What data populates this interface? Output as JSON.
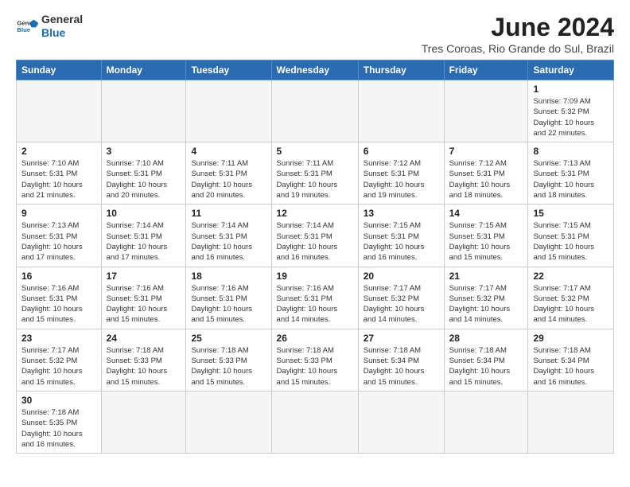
{
  "header": {
    "logo_general": "General",
    "logo_blue": "Blue",
    "title": "June 2024",
    "location": "Tres Coroas, Rio Grande do Sul, Brazil"
  },
  "days_of_week": [
    "Sunday",
    "Monday",
    "Tuesday",
    "Wednesday",
    "Thursday",
    "Friday",
    "Saturday"
  ],
  "weeks": [
    [
      {
        "day": null,
        "info": null
      },
      {
        "day": null,
        "info": null
      },
      {
        "day": null,
        "info": null
      },
      {
        "day": null,
        "info": null
      },
      {
        "day": null,
        "info": null
      },
      {
        "day": null,
        "info": null
      },
      {
        "day": "1",
        "info": "Sunrise: 7:09 AM\nSunset: 5:32 PM\nDaylight: 10 hours\nand 22 minutes."
      }
    ],
    [
      {
        "day": "2",
        "info": "Sunrise: 7:10 AM\nSunset: 5:31 PM\nDaylight: 10 hours\nand 21 minutes."
      },
      {
        "day": "3",
        "info": "Sunrise: 7:10 AM\nSunset: 5:31 PM\nDaylight: 10 hours\nand 20 minutes."
      },
      {
        "day": "4",
        "info": "Sunrise: 7:11 AM\nSunset: 5:31 PM\nDaylight: 10 hours\nand 20 minutes."
      },
      {
        "day": "5",
        "info": "Sunrise: 7:11 AM\nSunset: 5:31 PM\nDaylight: 10 hours\nand 19 minutes."
      },
      {
        "day": "6",
        "info": "Sunrise: 7:12 AM\nSunset: 5:31 PM\nDaylight: 10 hours\nand 19 minutes."
      },
      {
        "day": "7",
        "info": "Sunrise: 7:12 AM\nSunset: 5:31 PM\nDaylight: 10 hours\nand 18 minutes."
      },
      {
        "day": "8",
        "info": "Sunrise: 7:13 AM\nSunset: 5:31 PM\nDaylight: 10 hours\nand 18 minutes."
      }
    ],
    [
      {
        "day": "9",
        "info": "Sunrise: 7:13 AM\nSunset: 5:31 PM\nDaylight: 10 hours\nand 17 minutes."
      },
      {
        "day": "10",
        "info": "Sunrise: 7:14 AM\nSunset: 5:31 PM\nDaylight: 10 hours\nand 17 minutes."
      },
      {
        "day": "11",
        "info": "Sunrise: 7:14 AM\nSunset: 5:31 PM\nDaylight: 10 hours\nand 16 minutes."
      },
      {
        "day": "12",
        "info": "Sunrise: 7:14 AM\nSunset: 5:31 PM\nDaylight: 10 hours\nand 16 minutes."
      },
      {
        "day": "13",
        "info": "Sunrise: 7:15 AM\nSunset: 5:31 PM\nDaylight: 10 hours\nand 16 minutes."
      },
      {
        "day": "14",
        "info": "Sunrise: 7:15 AM\nSunset: 5:31 PM\nDaylight: 10 hours\nand 15 minutes."
      },
      {
        "day": "15",
        "info": "Sunrise: 7:15 AM\nSunset: 5:31 PM\nDaylight: 10 hours\nand 15 minutes."
      }
    ],
    [
      {
        "day": "16",
        "info": "Sunrise: 7:16 AM\nSunset: 5:31 PM\nDaylight: 10 hours\nand 15 minutes."
      },
      {
        "day": "17",
        "info": "Sunrise: 7:16 AM\nSunset: 5:31 PM\nDaylight: 10 hours\nand 15 minutes."
      },
      {
        "day": "18",
        "info": "Sunrise: 7:16 AM\nSunset: 5:31 PM\nDaylight: 10 hours\nand 15 minutes."
      },
      {
        "day": "19",
        "info": "Sunrise: 7:16 AM\nSunset: 5:31 PM\nDaylight: 10 hours\nand 14 minutes."
      },
      {
        "day": "20",
        "info": "Sunrise: 7:17 AM\nSunset: 5:32 PM\nDaylight: 10 hours\nand 14 minutes."
      },
      {
        "day": "21",
        "info": "Sunrise: 7:17 AM\nSunset: 5:32 PM\nDaylight: 10 hours\nand 14 minutes."
      },
      {
        "day": "22",
        "info": "Sunrise: 7:17 AM\nSunset: 5:32 PM\nDaylight: 10 hours\nand 14 minutes."
      }
    ],
    [
      {
        "day": "23",
        "info": "Sunrise: 7:17 AM\nSunset: 5:32 PM\nDaylight: 10 hours\nand 15 minutes."
      },
      {
        "day": "24",
        "info": "Sunrise: 7:18 AM\nSunset: 5:33 PM\nDaylight: 10 hours\nand 15 minutes."
      },
      {
        "day": "25",
        "info": "Sunrise: 7:18 AM\nSunset: 5:33 PM\nDaylight: 10 hours\nand 15 minutes."
      },
      {
        "day": "26",
        "info": "Sunrise: 7:18 AM\nSunset: 5:33 PM\nDaylight: 10 hours\nand 15 minutes."
      },
      {
        "day": "27",
        "info": "Sunrise: 7:18 AM\nSunset: 5:34 PM\nDaylight: 10 hours\nand 15 minutes."
      },
      {
        "day": "28",
        "info": "Sunrise: 7:18 AM\nSunset: 5:34 PM\nDaylight: 10 hours\nand 15 minutes."
      },
      {
        "day": "29",
        "info": "Sunrise: 7:18 AM\nSunset: 5:34 PM\nDaylight: 10 hours\nand 16 minutes."
      }
    ],
    [
      {
        "day": "30",
        "info": "Sunrise: 7:18 AM\nSunset: 5:35 PM\nDaylight: 10 hours\nand 16 minutes."
      },
      {
        "day": null,
        "info": null
      },
      {
        "day": null,
        "info": null
      },
      {
        "day": null,
        "info": null
      },
      {
        "day": null,
        "info": null
      },
      {
        "day": null,
        "info": null
      },
      {
        "day": null,
        "info": null
      }
    ]
  ]
}
